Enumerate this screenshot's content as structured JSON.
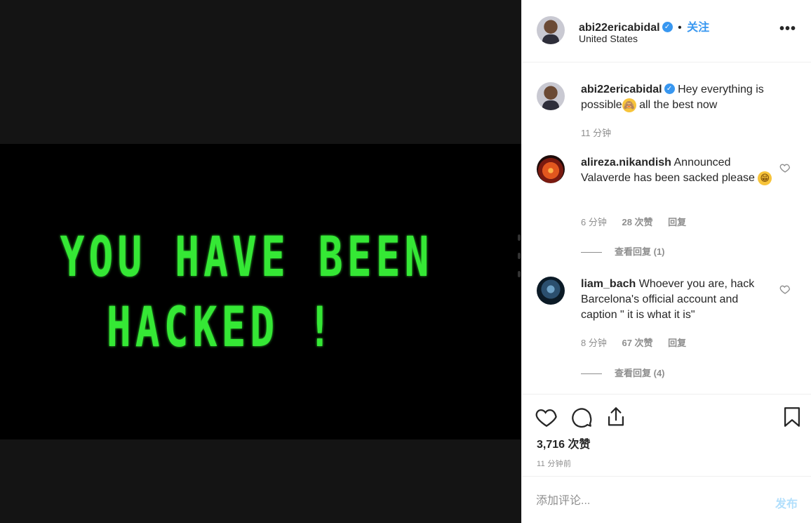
{
  "media": {
    "line1": "YOU HAVE BEEN",
    "line2": "HACKED !",
    "text_color": "#35e835"
  },
  "header": {
    "username": "abi22ericabidal",
    "separator": "•",
    "follow_label": "关注",
    "location": "United States",
    "more_icon": "more-horizontal-icon"
  },
  "caption": {
    "username": "abi22ericabidal",
    "text": "Hey everything is possible🙊 all the best now",
    "text_a": "Hey everything is possible",
    "emoji": "🙈",
    "text_b": " all the best now",
    "time": "11 分钟"
  },
  "comments": [
    {
      "username": "alireza.nikandish",
      "text": "Announced Valaverde has been sacked please 😁",
      "text_main": "Announced Valaverde has been sacked please",
      "emoji": "😁",
      "time": "6 分钟",
      "likes": "28 次赞",
      "reply_label": "回复",
      "view_replies": "查看回复 (1)"
    },
    {
      "username": "liam_bach",
      "text": "Whoever you are, hack Barcelona's official account and caption \" it is what it is\"",
      "time": "8 分钟",
      "likes": "67 次赞",
      "reply_label": "回复",
      "view_replies": "查看回复 (4)"
    }
  ],
  "actions": {
    "like_icon": "heart-icon",
    "comment_icon": "comment-icon",
    "share_icon": "share-icon",
    "save_icon": "bookmark-icon",
    "likes_count": "3,716 次赞",
    "time_ago": "11 分钟前"
  },
  "comment_box": {
    "placeholder": "添加评论...",
    "post_label": "发布"
  },
  "colors": {
    "accent": "#3897f0",
    "muted": "#8e8e8e",
    "post_disabled": "#b2dffc"
  }
}
